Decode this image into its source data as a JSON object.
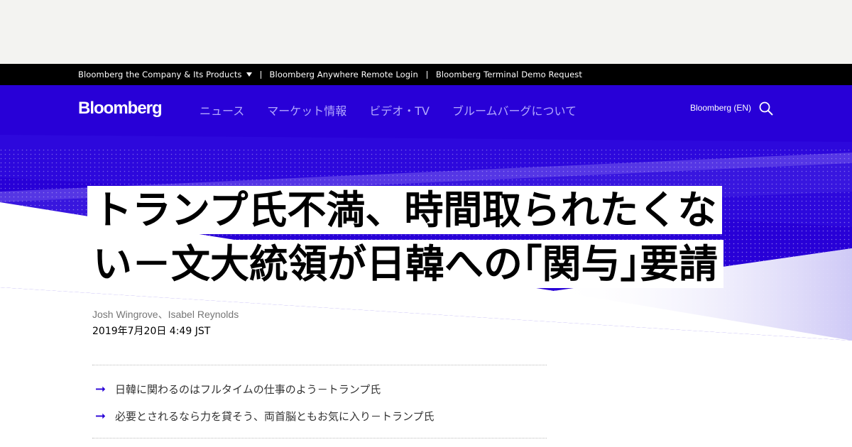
{
  "corp_bar": {
    "company_products": "Bloomberg the Company & Its Products",
    "anywhere_login": "Bloomberg Anywhere Remote Login",
    "terminal_demo": "Bloomberg Terminal Demo Request"
  },
  "nav": {
    "logo": "Bloomberg",
    "links": [
      "ニュース",
      "マーケット情報",
      "ビデオ・TV",
      "ブルームバーグについて"
    ],
    "edition": "Bloomberg (EN)",
    "search_icon": "search-icon"
  },
  "article": {
    "headline_line1": "トランプ氏不満、時間取られたくな",
    "headline_line2": "い－文大統領が日韓への｢関与｣要請",
    "byline": "Josh Wingrove、Isabel Reynolds",
    "date": "2019年7月20日 4:49 JST",
    "related": [
      "日韓に関わるのはフルタイムの仕事のよう－トランプ氏",
      "必要とされるなら力を貸そう、両首脳ともお気に入り－トランプ氏"
    ],
    "arrow_glyph": "➞"
  },
  "colors": {
    "brand_blue": "#2800d7",
    "nav_link": "#b3a8ff",
    "ad_strip": "#f3f3f1"
  }
}
